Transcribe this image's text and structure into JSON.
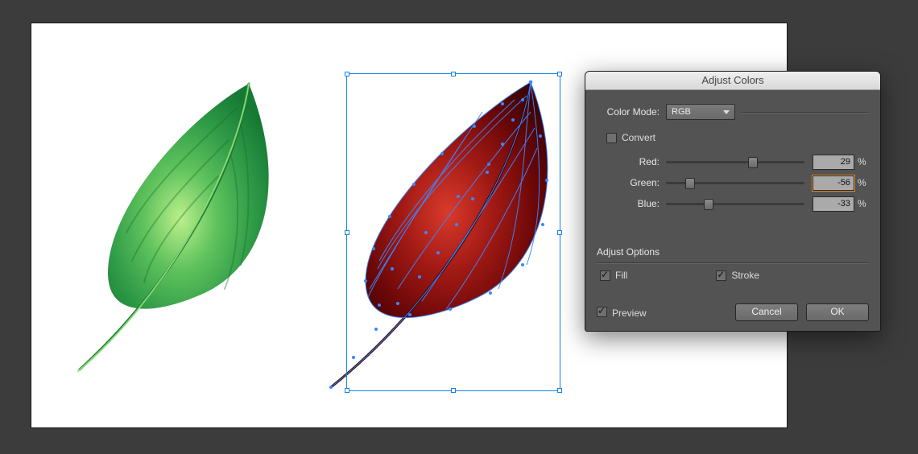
{
  "dialog": {
    "title": "Adjust Colors",
    "colorModeLabel": "Color Mode:",
    "colorModeValue": "RGB",
    "convertLabel": "Convert",
    "convertChecked": false,
    "sliders": {
      "red": {
        "label": "Red:",
        "value": 29,
        "pct": "%",
        "pos": 62
      },
      "green": {
        "label": "Green:",
        "value": -56,
        "pct": "%",
        "pos": 17,
        "highlight": true
      },
      "blue": {
        "label": "Blue:",
        "value": -33,
        "pct": "%",
        "pos": 30
      }
    },
    "adjustOptionsTitle": "Adjust Options",
    "fillLabel": "Fill",
    "fillChecked": true,
    "strokeLabel": "Stroke",
    "strokeChecked": true,
    "previewLabel": "Preview",
    "previewChecked": true,
    "cancelLabel": "Cancel",
    "okLabel": "OK"
  }
}
